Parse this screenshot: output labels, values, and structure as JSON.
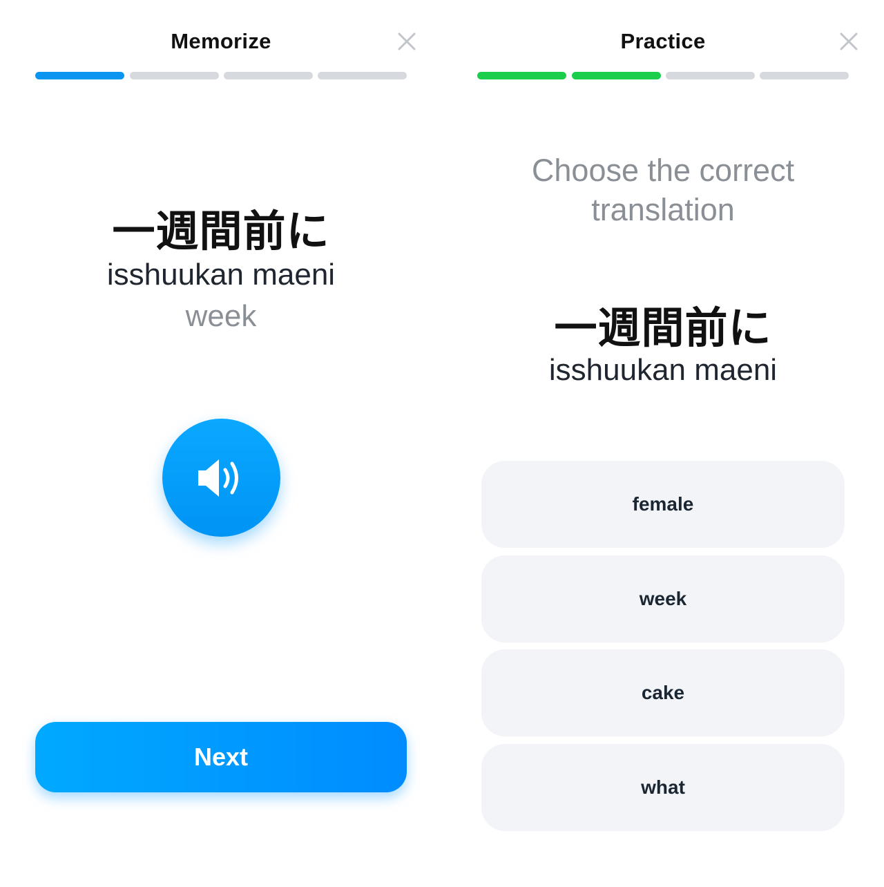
{
  "memorize": {
    "title": "Memorize",
    "progress": {
      "segments": 4,
      "completed": 1,
      "active_color": "#0a96f0",
      "inactive_color": "#d6d9de"
    },
    "word_japanese": "一週間前に",
    "word_romaji": "isshuukan maeni",
    "word_meaning": "week",
    "audio_icon": "speaker-icon",
    "next_label": "Next",
    "accent_color": "#0096ff"
  },
  "practice": {
    "title": "Practice",
    "progress": {
      "segments": 4,
      "completed": 2,
      "active_color": "#1bcf4c",
      "inactive_color": "#d6d9de"
    },
    "prompt_line1": "Choose the correct",
    "prompt_line2": "translation",
    "word_japanese": "一週間前に",
    "word_romaji": "isshuukan maeni",
    "options": [
      "female",
      "week",
      "cake",
      "what"
    ]
  },
  "close_icon": "close-icon"
}
